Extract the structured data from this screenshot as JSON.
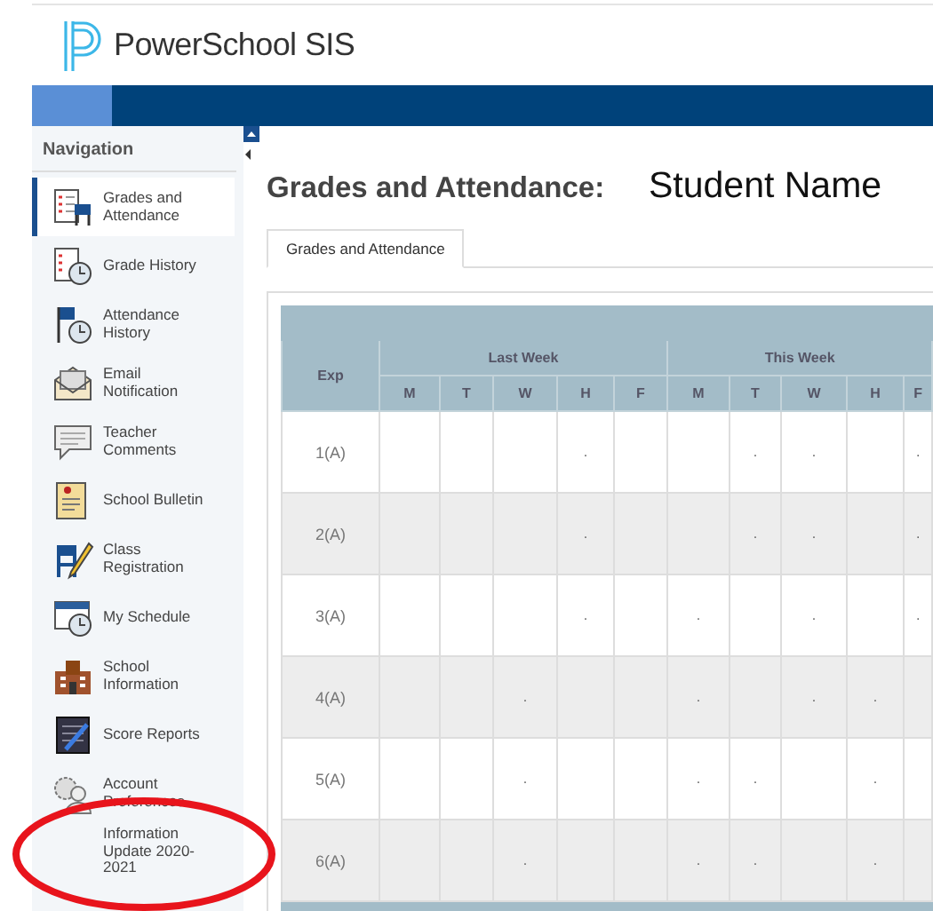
{
  "header": {
    "title": "PowerSchool SIS"
  },
  "navigation": {
    "title": "Navigation",
    "items": [
      {
        "label": "Grades and Attendance",
        "selected": true
      },
      {
        "label": "Grade History",
        "selected": false
      },
      {
        "label": "Attendance History",
        "selected": false
      },
      {
        "label": "Email Notification",
        "selected": false
      },
      {
        "label": "Teacher Comments",
        "selected": false
      },
      {
        "label": "School Bulletin",
        "selected": false
      },
      {
        "label": "Class Registration",
        "selected": false
      },
      {
        "label": "My Schedule",
        "selected": false
      },
      {
        "label": "School Information",
        "selected": false
      },
      {
        "label": "Score Reports",
        "selected": false
      },
      {
        "label": "Account Preferences",
        "selected": false
      },
      {
        "label": "Information Update 2020-2021",
        "selected": false
      }
    ]
  },
  "page": {
    "title": "Grades and Attendance:",
    "student": "Student Name"
  },
  "tabs": [
    {
      "label": "Grades and Attendance",
      "selected": true
    }
  ],
  "table": {
    "first_column": "Exp",
    "groups": [
      "Last Week",
      "This Week"
    ],
    "days": [
      "M",
      "T",
      "W",
      "H",
      "F",
      "M",
      "T",
      "W",
      "H",
      "F"
    ],
    "rows": [
      {
        "exp": "1(A)",
        "cells": [
          null,
          null,
          null,
          ".",
          null,
          null,
          ".",
          ".",
          null,
          "."
        ]
      },
      {
        "exp": "2(A)",
        "cells": [
          null,
          null,
          null,
          ".",
          null,
          null,
          ".",
          ".",
          null,
          "."
        ]
      },
      {
        "exp": "3(A)",
        "cells": [
          null,
          null,
          null,
          ".",
          null,
          ".",
          null,
          ".",
          null,
          "."
        ]
      },
      {
        "exp": "4(A)",
        "cells": [
          null,
          null,
          ".",
          null,
          null,
          ".",
          null,
          ".",
          ".",
          null
        ]
      },
      {
        "exp": "5(A)",
        "cells": [
          null,
          null,
          ".",
          null,
          null,
          ".",
          ".",
          null,
          ".",
          null
        ]
      },
      {
        "exp": "6(A)",
        "cells": [
          null,
          null,
          ".",
          null,
          null,
          ".",
          ".",
          null,
          ".",
          null
        ]
      }
    ]
  },
  "annotation": {
    "kind": "ellipse"
  }
}
